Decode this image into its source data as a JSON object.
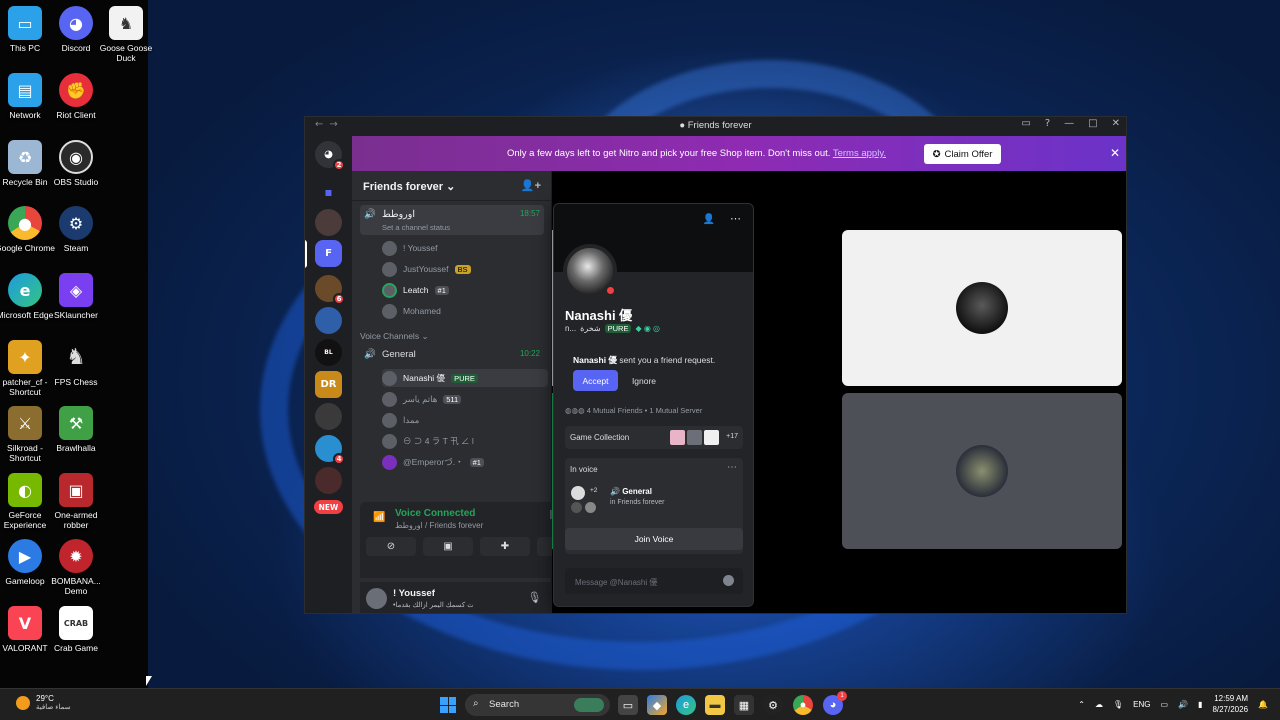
{
  "desktop_icons": [
    {
      "label": "This PC",
      "icon": "monitor-icon",
      "color": "#2aa1e8"
    },
    {
      "label": "Discord",
      "icon": "discord-icon",
      "color": "#5865f2"
    },
    {
      "label": "Goose Goose Duck",
      "icon": "goose-icon",
      "color": "#f2f2f2"
    },
    {
      "label": "Network",
      "icon": "network-icon",
      "color": "#2aa1e8"
    },
    {
      "label": "Riot Client",
      "icon": "riot-icon",
      "color": "#e62f3a"
    },
    {
      "label": "Recycle Bin",
      "icon": "recycle-bin-icon",
      "color": "#9bb7d4"
    },
    {
      "label": "OBS Studio",
      "icon": "obs-icon",
      "color": "#2a2a2a"
    },
    {
      "label": "Google Chrome",
      "icon": "chrome-icon",
      "color": "#e8453c"
    },
    {
      "label": "Steam",
      "icon": "steam-icon",
      "color": "#1b3b6f"
    },
    {
      "label": "Microsoft Edge",
      "icon": "edge-icon",
      "color": "#1e9be0"
    },
    {
      "label": "SKlauncher",
      "icon": "sklauncher-icon",
      "color": "#7b3ff2"
    },
    {
      "label": "patcher_cf - Shortcut",
      "icon": "patcher-icon",
      "color": "#e0a020"
    },
    {
      "label": "FPS Chess",
      "icon": "chess-icon",
      "color": "#dddddd"
    },
    {
      "label": "Silkroad - Shortcut",
      "icon": "silkroad-icon",
      "color": "#8a6d2f"
    },
    {
      "label": "Brawlhalla",
      "icon": "brawlhalla-icon",
      "color": "#3fa046"
    },
    {
      "label": "GeForce Experience",
      "icon": "geforce-icon",
      "color": "#76b900"
    },
    {
      "label": "One-armed robber",
      "icon": "robber-icon",
      "color": "#b8282c"
    },
    {
      "label": "Gameloop",
      "icon": "gameloop-icon",
      "color": "#2c7be5"
    },
    {
      "label": "BOMBANA... Demo",
      "icon": "bombana-icon",
      "color": "#c0242c"
    },
    {
      "label": "VALORANT",
      "icon": "valorant-icon",
      "color": "#fa4454"
    },
    {
      "label": "Crab Game",
      "icon": "crab-game-icon",
      "color": "#ffffff"
    }
  ],
  "discord": {
    "window_title": "Friends forever",
    "nitro_banner": {
      "message": "Only a few days left to get Nitro and pick your free Shop item. Don't miss out.",
      "link": "Terms apply.",
      "button": "Claim Offer"
    },
    "server_new_badge": "NEW",
    "server_badges": {
      "home": "2",
      "s2": "6",
      "s4": "4"
    },
    "server_name": "Friends forever",
    "channels": [
      {
        "name": "اوروطط",
        "time": "18:57",
        "status": "Set a channel status"
      }
    ],
    "stage_users_top": [
      {
        "name": "! Youssef"
      },
      {
        "name": "JustYoussef",
        "tag": "BS"
      },
      {
        "name": "Leatch",
        "tag": "#1"
      },
      {
        "name": "Mohamed"
      }
    ],
    "voice_category": "Voice Channels",
    "voice_channel": {
      "name": "General",
      "time": "10:22"
    },
    "voice_users": [
      {
        "name": "Nanashi 優",
        "tag": "PURE"
      },
      {
        "name": "هاتم ياسر",
        "tag": "511"
      },
      {
        "name": "ممدا"
      },
      {
        "name": "⊖ ⊃ 4 ラ T 卂 ∠ ǀ"
      },
      {
        "name": "@Emperorづ.・",
        "tag": "#1"
      }
    ],
    "voice_connected": {
      "status": "Voice Connected",
      "location": "اوروطط / Friends forever"
    },
    "user_panel": {
      "name": "! Youssef",
      "status": "•خلت كسمك اليمر ازالك بقدما"
    },
    "profile": {
      "display_name": "Nanashi 優",
      "username": "n...",
      "username_extra": "شخرة",
      "guild_tag": "PURE",
      "friend_request_name": "Nanashi 優",
      "friend_request_text": "sent you a friend request.",
      "accept": "Accept",
      "ignore": "Ignore",
      "mutual_friends": "4 Mutual Friends",
      "mutual_servers": "1 Mutual Server",
      "game_collection": "Game Collection",
      "game_more": "+17",
      "in_voice": "In voice",
      "voice_extra": "+2",
      "voice_channel": "General",
      "voice_server": "in Friends forever",
      "join_voice": "Join Voice",
      "message_placeholder": "Message @Nanashi 優"
    }
  },
  "taskbar": {
    "weather_temp": "29°C",
    "weather_desc": "سماء صافية",
    "search_placeholder": "Search",
    "lang": "ENG",
    "time": "12:59 AM",
    "date": "8/27/2026",
    "discord_badge": "1"
  },
  "colors": {
    "discord_bg": "#1e1f22",
    "sidebar_bg": "#2b2d31",
    "accent": "#5865f2",
    "online_green": "#23a55a",
    "dnd_red": "#f23f43",
    "nitro_gradient_start": "#7a2f8f"
  }
}
